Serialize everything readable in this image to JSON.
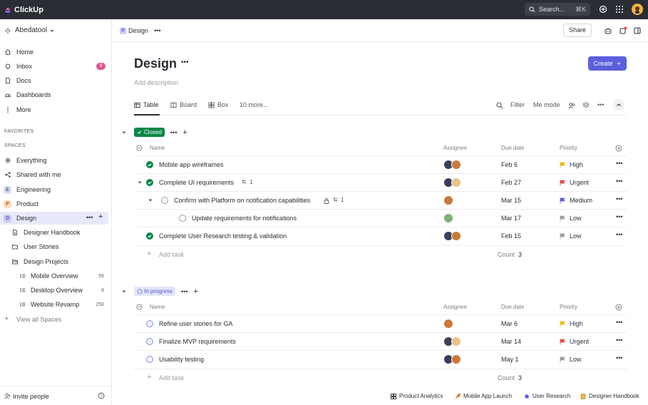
{
  "app": {
    "name": "ClickUp"
  },
  "topbar": {
    "search_placeholder": "Search...",
    "search_shortcut": "⌘K"
  },
  "sidebar": {
    "workspace": "Abedatool",
    "nav": [
      {
        "label": "Home"
      },
      {
        "label": "Inbox",
        "badge": "9"
      },
      {
        "label": "Docs"
      },
      {
        "label": "Dashboards"
      },
      {
        "label": "More"
      }
    ],
    "favorites_label": "FAVORITES",
    "spaces_label": "SPACES",
    "spaces": [
      {
        "label": "Everything"
      },
      {
        "label": "Shared with me"
      },
      {
        "label": "Engineering",
        "letter": "E"
      },
      {
        "label": "Product",
        "letter": "P"
      },
      {
        "label": "Design",
        "letter": "D"
      }
    ],
    "design_children": [
      {
        "label": "Designer Handbook"
      },
      {
        "label": "User Stories"
      },
      {
        "label": "Design Projects"
      }
    ],
    "projects": [
      {
        "label": "Mobile Overview",
        "count": "56"
      },
      {
        "label": "Desktop Overview",
        "count": "8"
      },
      {
        "label": "Website Revamp",
        "count": "256"
      }
    ],
    "view_all": "View all Spaces",
    "invite": "Invite people"
  },
  "header": {
    "breadcrumb": "Design",
    "breadcrumb_letter": "D",
    "share": "Share",
    "title": "Design",
    "add_description": "Add description",
    "create": "Create"
  },
  "views": {
    "tabs": [
      {
        "label": "Table"
      },
      {
        "label": "Board"
      },
      {
        "label": "Box"
      },
      {
        "label": "10 more..."
      }
    ],
    "filter": "Filter",
    "me_mode": "Me mode"
  },
  "columns": {
    "name": "Name",
    "assignee": "Assignee",
    "due": "Due date",
    "priority": "Priority"
  },
  "groups": [
    {
      "status": "Closed",
      "tasks": [
        {
          "name": "Mobile app wireframes",
          "due": "Feb 6",
          "priority": "High"
        },
        {
          "name": "Complete UI requirements",
          "subtasks": "1",
          "due": "Feb 27",
          "priority": "Urgent"
        },
        {
          "name": "Confirm with Platform on notification capabilities",
          "subtasks": "1",
          "due": "Mar 15",
          "priority": "Medium"
        },
        {
          "name": "Update requirements for notifications",
          "due": "Mar 17",
          "priority": "Low"
        },
        {
          "name": "Complete User Research testing & validation",
          "due": "Feb 15",
          "priority": "Low"
        }
      ],
      "add_task": "Add task",
      "count_label": "Count",
      "count": "3"
    },
    {
      "status": "In progress",
      "tasks": [
        {
          "name": "Refine user stories for GA",
          "due": "Mar 6",
          "priority": "High"
        },
        {
          "name": "Finalize MVP requirements",
          "due": "Mar 14",
          "priority": "Urgent"
        },
        {
          "name": "Usability testing",
          "due": "May 1",
          "priority": "Low"
        }
      ],
      "add_task": "Add task",
      "count_label": "Count",
      "count": "3"
    }
  ],
  "priority_colors": {
    "High": "#f5b800",
    "Urgent": "#e5484d",
    "Medium": "#5a5fdc",
    "Low": "#9a9ca2"
  },
  "bottombar": [
    {
      "label": "Product Analytics"
    },
    {
      "label": "Mobile App Launch"
    },
    {
      "label": "User Research"
    },
    {
      "label": "Designer Handbook"
    }
  ]
}
